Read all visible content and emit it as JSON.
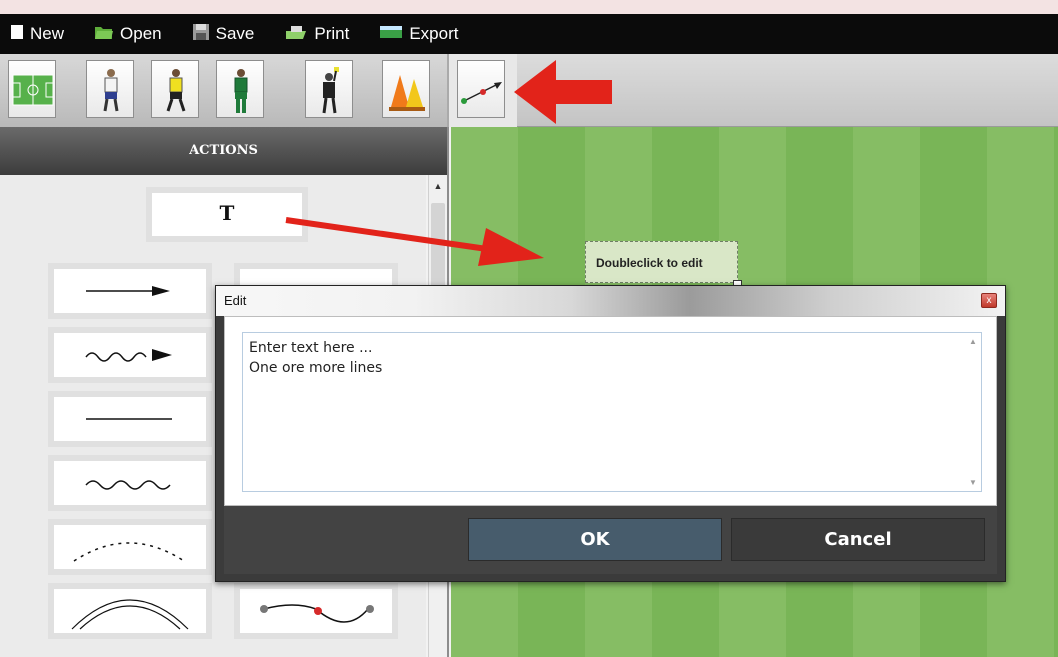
{
  "menu": {
    "items": [
      {
        "label": "New",
        "icon": "new-document-icon"
      },
      {
        "label": "Open",
        "icon": "folder-open-icon"
      },
      {
        "label": "Save",
        "icon": "floppy-disk-icon"
      },
      {
        "label": "Print",
        "icon": "printer-icon"
      },
      {
        "label": "Export",
        "icon": "export-image-icon"
      }
    ]
  },
  "toolbar": {
    "tools": [
      {
        "name": "field-tool",
        "icon": "soccer-field-icon"
      },
      {
        "name": "player-white-tool",
        "icon": "player-white-icon"
      },
      {
        "name": "player-yellow-tool",
        "icon": "player-yellow-icon"
      },
      {
        "name": "player-green-tool",
        "icon": "player-green-icon"
      },
      {
        "name": "referee-tool",
        "icon": "referee-icon"
      },
      {
        "name": "cones-tool",
        "icon": "cones-icon"
      },
      {
        "name": "arrow-tool",
        "icon": "arrow-line-icon"
      }
    ]
  },
  "actions": {
    "header": "ACTIONS",
    "text_tile_label": "T"
  },
  "field": {
    "textbox_label": "Doubleclick to edit"
  },
  "dialog": {
    "title": "Edit",
    "close_label": "x",
    "textarea_value": "Enter text here ...\nOne ore more lines",
    "ok_label": "OK",
    "cancel_label": "Cancel"
  },
  "colors": {
    "field_light": "#86bd64",
    "field_dark": "#79b557",
    "annotation_red": "#e2231a",
    "ok_button": "#475c6c"
  }
}
